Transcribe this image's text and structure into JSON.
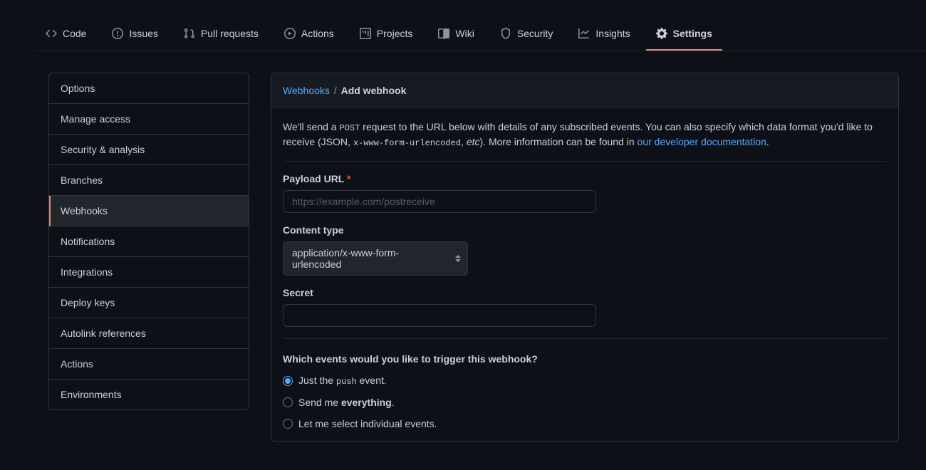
{
  "tabs": [
    {
      "id": "code",
      "label": "Code"
    },
    {
      "id": "issues",
      "label": "Issues"
    },
    {
      "id": "pulls",
      "label": "Pull requests"
    },
    {
      "id": "actions",
      "label": "Actions"
    },
    {
      "id": "projects",
      "label": "Projects"
    },
    {
      "id": "wiki",
      "label": "Wiki"
    },
    {
      "id": "security",
      "label": "Security"
    },
    {
      "id": "insights",
      "label": "Insights"
    },
    {
      "id": "settings",
      "label": "Settings"
    }
  ],
  "active_tab": "settings",
  "sidebar": {
    "items": [
      "Options",
      "Manage access",
      "Security & analysis",
      "Branches",
      "Webhooks",
      "Notifications",
      "Integrations",
      "Deploy keys",
      "Autolink references",
      "Actions",
      "Environments"
    ],
    "active": "Webhooks"
  },
  "breadcrumb": {
    "parent": "Webhooks",
    "sep": "/",
    "current": "Add webhook"
  },
  "description": {
    "pre": "We'll send a ",
    "code1": "POST",
    "mid1": " request to the URL below with details of any subscribed events. You can also specify which data format you'd like to receive (JSON, ",
    "code2": "x-www-form-urlencoded",
    "mid2": ", ",
    "em": "etc",
    "mid3": "). More information can be found in ",
    "link": "our developer documentation",
    "post": "."
  },
  "form": {
    "payload_label": "Payload URL",
    "payload_placeholder": "https://example.com/postreceive",
    "content_type_label": "Content type",
    "content_type_value": "application/x-www-form-urlencoded",
    "secret_label": "Secret",
    "events_title": "Which events would you like to trigger this webhook?",
    "radio1_pre": "Just the ",
    "radio1_code": "push",
    "radio1_post": " event.",
    "radio2_pre": "Send me ",
    "radio2_strong": "everything",
    "radio2_post": ".",
    "radio3": "Let me select individual events."
  }
}
